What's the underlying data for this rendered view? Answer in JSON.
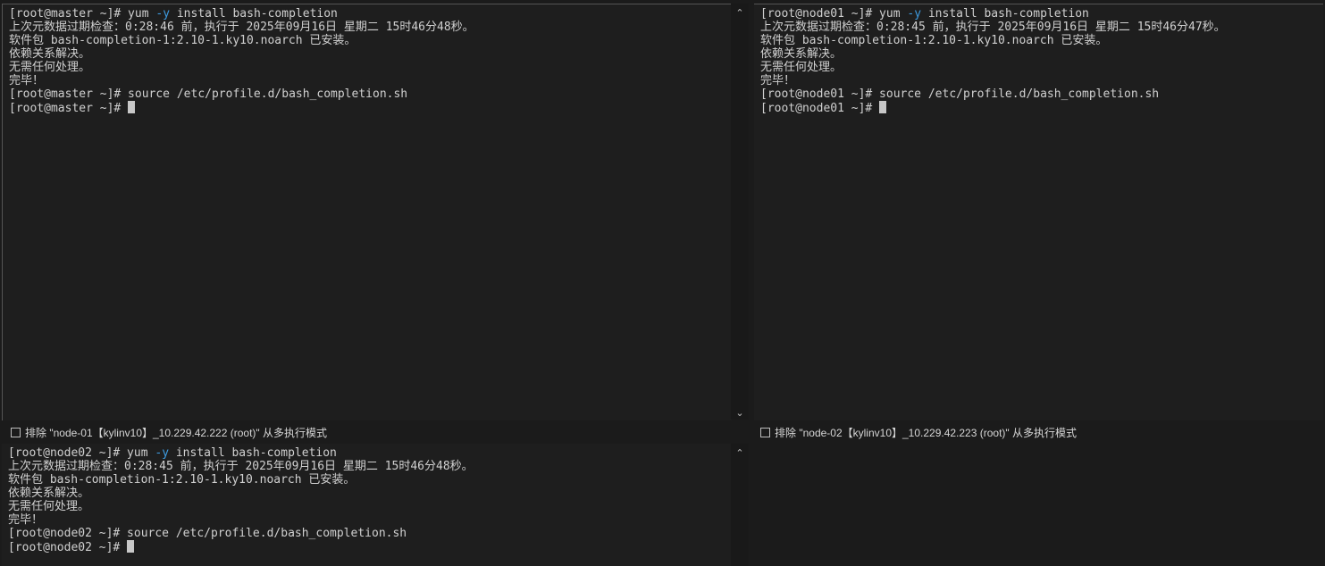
{
  "panes": {
    "master": {
      "lines": [
        [
          "[root@master ~]# yum ",
          "-y",
          " install bash-completion"
        ],
        "上次元数据过期检查：0:28:46 前，执行于 2025年09月16日 星期二 15时46分48秒。",
        "软件包 bash-completion-1:2.10-1.ky10.noarch 已安装。",
        "依赖关系解决。",
        "无需任何处理。",
        "完毕！",
        "[root@master ~]# source /etc/profile.d/bash_completion.sh",
        "[root@master ~]# "
      ]
    },
    "node01": {
      "lines": [
        [
          "[root@node01 ~]# yum ",
          "-y",
          " install bash-completion"
        ],
        "上次元数据过期检查：0:28:45 前，执行于 2025年09月16日 星期二 15时46分47秒。",
        "软件包 bash-completion-1:2.10-1.ky10.noarch 已安装。",
        "依赖关系解决。",
        "无需任何处理。",
        "完毕！",
        "[root@node01 ~]# source /etc/profile.d/bash_completion.sh",
        "[root@node01 ~]# "
      ]
    },
    "node02": {
      "lines": [
        [
          "[root@node02 ~]# yum ",
          "-y",
          " install bash-completion"
        ],
        "上次元数据过期检查：0:28:45 前，执行于 2025年09月16日 星期二 15时46分48秒。",
        "软件包 bash-completion-1:2.10-1.ky10.noarch 已安装。",
        "依赖关系解决。",
        "无需任何处理。",
        "完毕！",
        "[root@node02 ~]# source /etc/profile.d/bash_completion.sh",
        "[root@node02 ~]# "
      ]
    }
  },
  "exclude_bars": {
    "left": "排除 \"node-01【kylinv10】_10.229.42.222 (root)\" 从多执行模式",
    "right": "排除 \"node-02【kylinv10】_10.229.42.223 (root)\" 从多执行模式"
  },
  "scroll_glyphs": {
    "up": "⌃",
    "down": "⌄"
  },
  "colors": {
    "terminal_bg": "#1e1e1e",
    "text": "#d0d0d0",
    "option_flag": "#3d9be0"
  }
}
